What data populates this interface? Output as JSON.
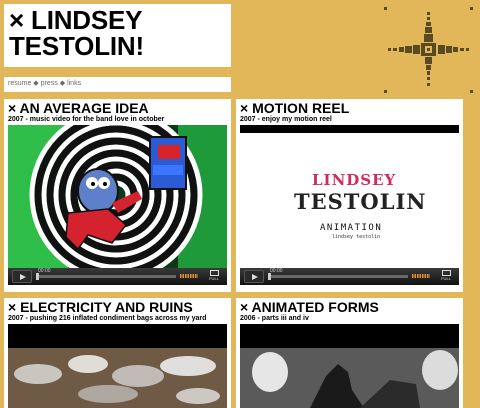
{
  "header": {
    "title_line1": "× LINDSEY",
    "title_line2": "TESTOLIN!"
  },
  "nav": {
    "items": [
      "resume",
      "press",
      "links"
    ],
    "separator": "◆"
  },
  "cards": [
    {
      "title": "× AN AVERAGE IDEA",
      "subtitle": "2007 - music video for the band love in october",
      "player": {
        "time": "00:00",
        "full_label": "FULL"
      }
    },
    {
      "title": "× MOTION REEL",
      "subtitle": "2007 - enjoy my motion reel",
      "player": {
        "time": "00:00",
        "full_label": "FULL"
      },
      "thumbnail": {
        "line1": "LINDSEY",
        "line2": "TESTOLIN",
        "line3": "ANIMATION",
        "line4": "lindsey testolin"
      }
    },
    {
      "title": "× ELECTRICITY AND RUINS",
      "subtitle": "2007 - pushing 216 inflated condiment bags across my yard"
    },
    {
      "title": "× ANIMATED FORMS",
      "subtitle": "2006 - parts iii and iv"
    }
  ],
  "colors": {
    "background": "#E2B75A",
    "panel": "#FFFFFF",
    "logo": "#5a4a22"
  },
  "icons": [
    "play-icon",
    "fullscreen-icon",
    "compass-logo-icon"
  ]
}
